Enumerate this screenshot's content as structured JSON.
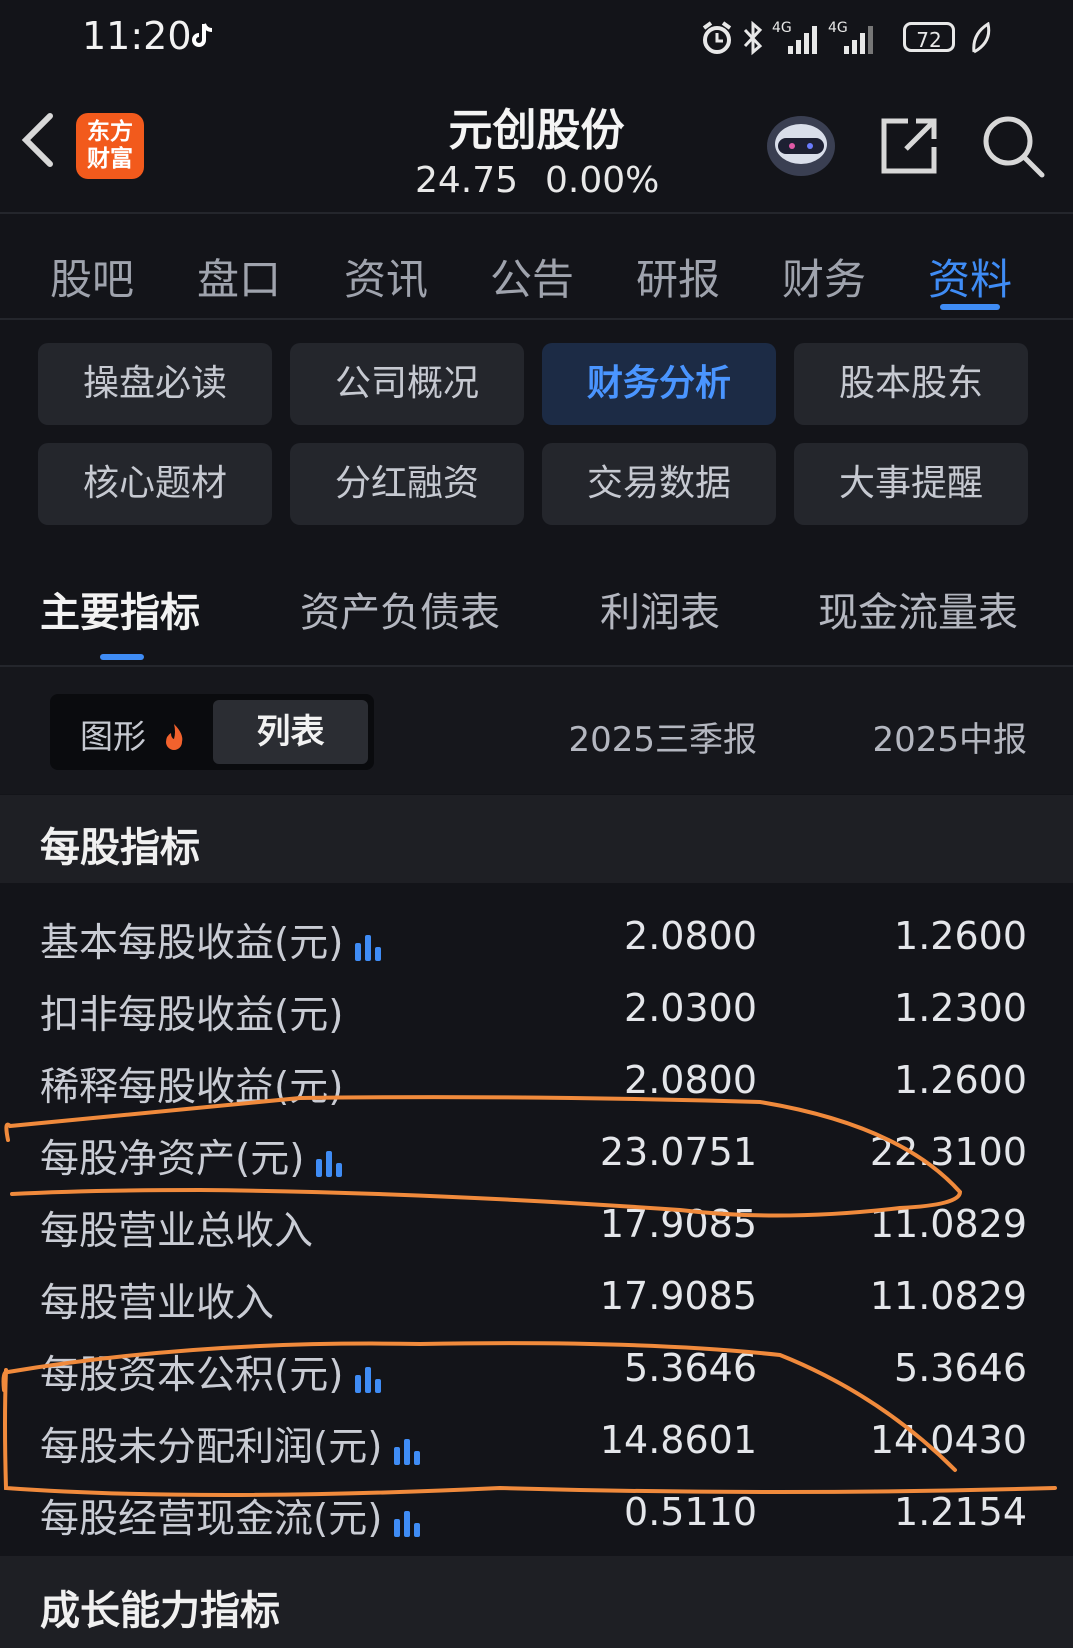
{
  "status_bar": {
    "time": "11:20",
    "network_1": "4G",
    "network_2": "4G",
    "battery": "72"
  },
  "header": {
    "logo_line1": "东方",
    "logo_line2": "财富",
    "stock_name": "元创股份",
    "price": "24.75",
    "change_pct": "0.00%"
  },
  "top_tabs": [
    "股吧",
    "盘口",
    "资讯",
    "公告",
    "研报",
    "财务",
    "资料"
  ],
  "top_tab_active": "资料",
  "chips": [
    "操盘必读",
    "公司概况",
    "财务分析",
    "股本股东",
    "核心题材",
    "分红融资",
    "交易数据",
    "大事提醒"
  ],
  "chip_active": "财务分析",
  "sub_tabs": [
    "主要指标",
    "资产负债表",
    "利润表",
    "现金流量表"
  ],
  "view_toggle": {
    "graph": "图形",
    "list": "列表"
  },
  "periods": [
    "2025三季报",
    "2025中报"
  ],
  "section_per_share": "每股指标",
  "rows": [
    {
      "label": "基本每股收益(元)",
      "chart": true,
      "v1": "2.0800",
      "v2": "1.2600"
    },
    {
      "label": "扣非每股收益(元)",
      "chart": false,
      "v1": "2.0300",
      "v2": "1.2300"
    },
    {
      "label": "稀释每股收益(元)",
      "chart": false,
      "v1": "2.0800",
      "v2": "1.2600"
    },
    {
      "label": "每股净资产(元)",
      "chart": true,
      "v1": "23.0751",
      "v2": "22.3100"
    },
    {
      "label": "每股营业总收入",
      "chart": false,
      "v1": "17.9085",
      "v2": "11.0829"
    },
    {
      "label": "每股营业收入",
      "chart": false,
      "v1": "17.9085",
      "v2": "11.0829"
    },
    {
      "label": "每股资本公积(元)",
      "chart": true,
      "v1": "5.3646",
      "v2": "5.3646"
    },
    {
      "label": "每股未分配利润(元)",
      "chart": true,
      "v1": "14.8601",
      "v2": "14.0430"
    },
    {
      "label": "每股经营现金流(元)",
      "chart": true,
      "v1": "0.5110",
      "v2": "1.2154"
    }
  ],
  "section_growth": "成长能力指标",
  "colors": {
    "accent": "#3f8cf5",
    "logo": "#f25a1c",
    "annotation": "#f08a3c"
  }
}
